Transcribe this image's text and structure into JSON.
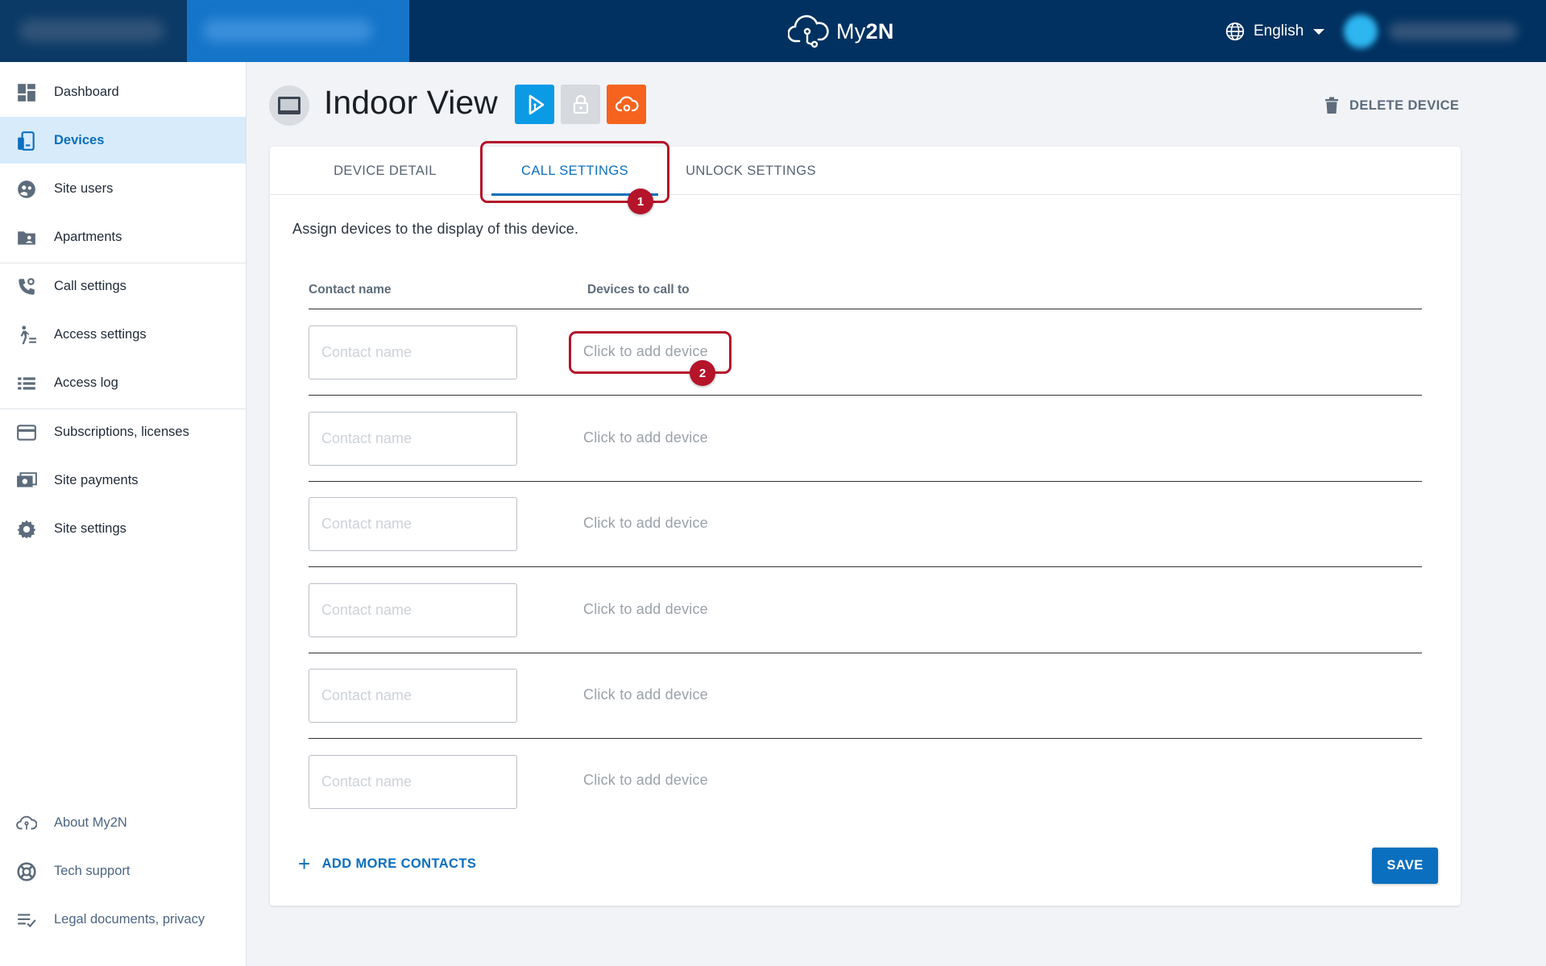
{
  "app": {
    "logo_text_prefix": "My",
    "logo_text_bold": "2N",
    "language": "English"
  },
  "sidebar": {
    "items": [
      {
        "label": "Dashboard",
        "icon": "dashboard-icon"
      },
      {
        "label": "Devices",
        "icon": "devices-icon",
        "active": true
      },
      {
        "label": "Site users",
        "icon": "site-users-icon"
      },
      {
        "label": "Apartments",
        "icon": "apartments-icon"
      },
      {
        "label": "Call settings",
        "icon": "call-settings-icon"
      },
      {
        "label": "Access settings",
        "icon": "access-settings-icon"
      },
      {
        "label": "Access log",
        "icon": "access-log-icon"
      },
      {
        "label": "Subscriptions, licenses",
        "icon": "card-icon"
      },
      {
        "label": "Site payments",
        "icon": "payments-icon"
      },
      {
        "label": "Site settings",
        "icon": "gear-icon"
      }
    ],
    "footer_items": [
      {
        "label": "About My2N",
        "icon": "cloud-icon"
      },
      {
        "label": "Tech support",
        "icon": "lifebuoy-icon"
      },
      {
        "label": "Legal documents, privacy",
        "icon": "checklist-icon"
      }
    ]
  },
  "device": {
    "title": "Indoor View",
    "delete_label": "DELETE DEVICE",
    "badges": [
      {
        "icon": "play-badge-icon",
        "color": "#0a9ae6"
      },
      {
        "icon": "lock-badge-icon",
        "color": "#d6d9dd"
      },
      {
        "icon": "cloud-gear-badge-icon",
        "color": "#f5631e"
      }
    ]
  },
  "tabs": [
    {
      "label": "DEVICE DETAIL"
    },
    {
      "label": "CALL SETTINGS",
      "active": true
    },
    {
      "label": "UNLOCK SETTINGS"
    }
  ],
  "call_settings": {
    "intro": "Assign devices to the display of this device.",
    "col_contact": "Contact name",
    "col_devices": "Devices to call to",
    "contact_placeholder": "Contact name",
    "add_device_text": "Click to add device",
    "rows": [
      {
        "contact": ""
      },
      {
        "contact": ""
      },
      {
        "contact": ""
      },
      {
        "contact": ""
      },
      {
        "contact": ""
      },
      {
        "contact": ""
      }
    ],
    "add_more_label": "ADD MORE CONTACTS",
    "save_label": "SAVE"
  },
  "annotations": [
    {
      "number": "1",
      "color": "#b5142a"
    },
    {
      "number": "2",
      "color": "#b5142a"
    }
  ]
}
